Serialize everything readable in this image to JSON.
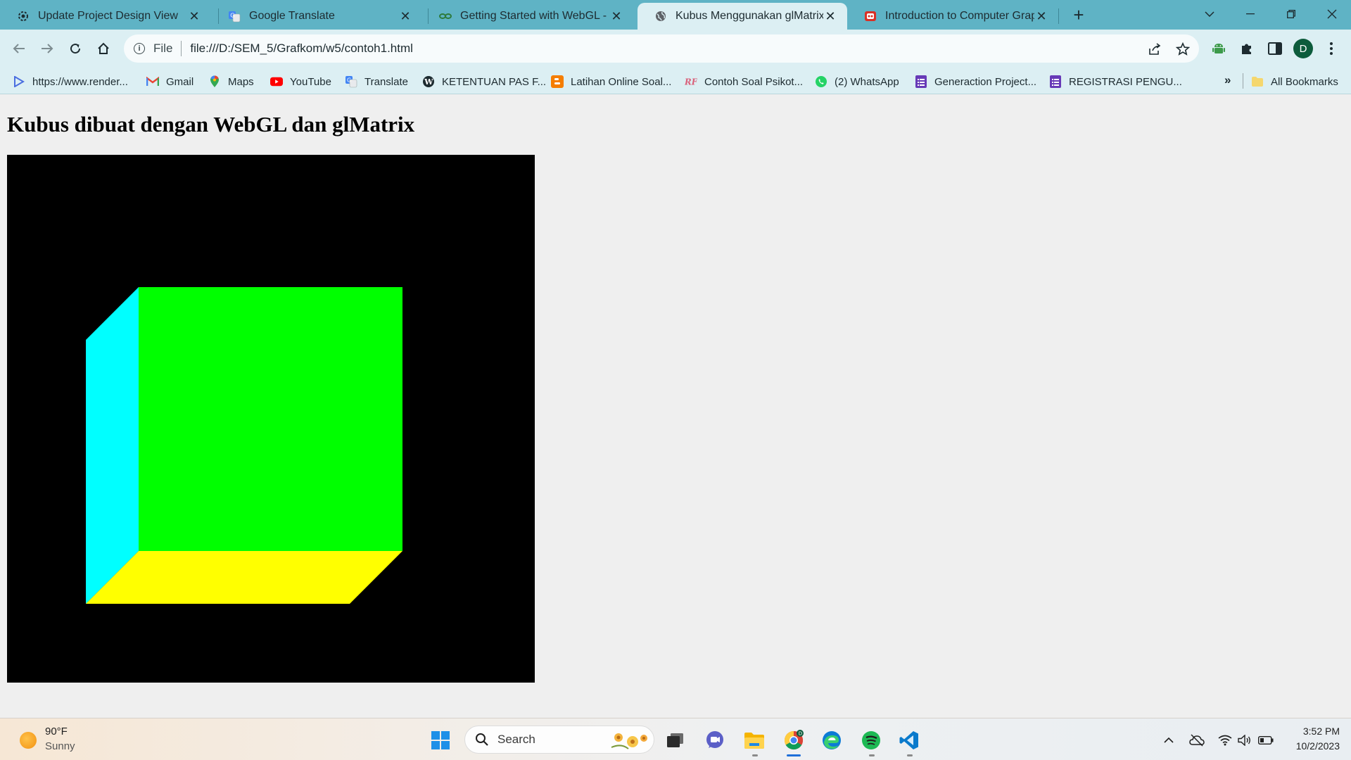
{
  "browser": {
    "tabs": [
      {
        "title": "Update Project Design View",
        "icon": "gear-icon",
        "active": false
      },
      {
        "title": "Google Translate",
        "icon": "google-translate-icon",
        "active": false
      },
      {
        "title": "Getting Started with WebGL - Gu",
        "icon": "link-icon",
        "active": false
      },
      {
        "title": "Kubus Menggunakan glMatrix d",
        "icon": "globe-icon",
        "active": true
      },
      {
        "title": "Introduction to Computer Graph",
        "icon": "pdf-icon",
        "active": false
      }
    ],
    "address": {
      "scheme": "File",
      "url": "file:///D:/SEM_5/Grafkom/w5/contoh1.html"
    },
    "avatar_letter": "D",
    "bookmarks": [
      {
        "label": "https://www.render...",
        "icon": "render-icon"
      },
      {
        "label": "Gmail",
        "icon": "gmail-icon"
      },
      {
        "label": "Maps",
        "icon": "maps-icon"
      },
      {
        "label": "YouTube",
        "icon": "youtube-icon"
      },
      {
        "label": "Translate",
        "icon": "translate-icon"
      },
      {
        "label": "KETENTUAN PAS F...",
        "icon": "wordpress-icon"
      },
      {
        "label": "Latihan Online Soal...",
        "icon": "blogger-icon"
      },
      {
        "label": "Contoh Soal Psikot...",
        "icon": "site-icon"
      },
      {
        "label": "(2) WhatsApp",
        "icon": "whatsapp-icon"
      },
      {
        "label": "Generaction Project...",
        "icon": "forms-icon"
      },
      {
        "label": "REGISTRASI PENGU...",
        "icon": "forms-icon"
      }
    ],
    "bookmarks_more": "»",
    "all_bookmarks": "All Bookmarks"
  },
  "page": {
    "heading": "Kubus dibuat dengan WebGL dan glMatrix",
    "cube_colors": {
      "front": "#00ff00",
      "left": "#00ffff",
      "bottom": "#ffff00",
      "background": "#000000"
    }
  },
  "taskbar": {
    "weather_temp": "90°F",
    "weather_desc": "Sunny",
    "search_placeholder": "Search",
    "time": "3:52 PM",
    "date": "10/2/2023"
  }
}
